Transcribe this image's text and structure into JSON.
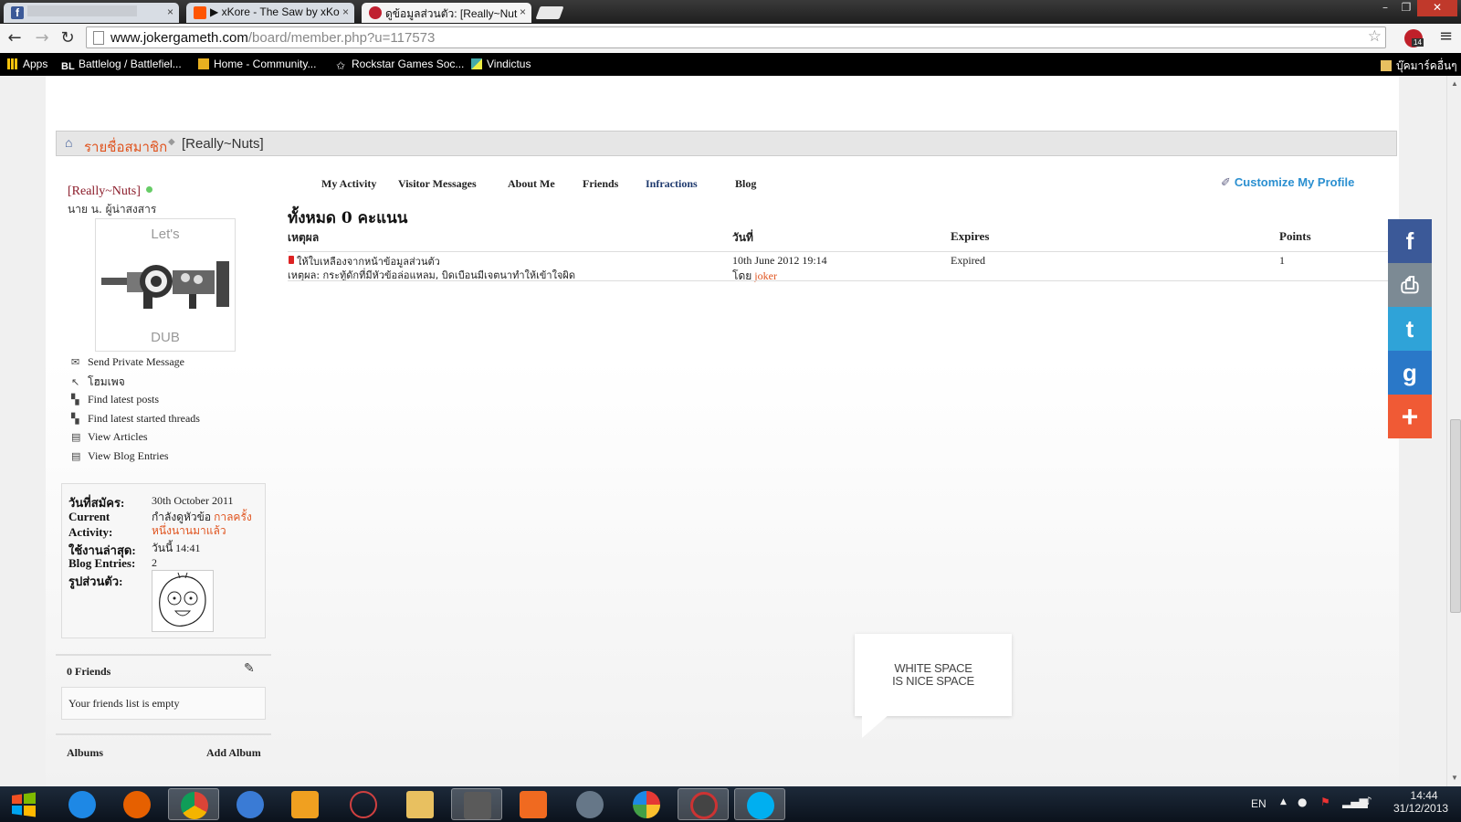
{
  "browser": {
    "tabs": [
      {
        "title": "",
        "icon": "facebook-icon",
        "color": "#3b5998"
      },
      {
        "title": "▶ xKore - The Saw by xKo",
        "icon": "soundcloud-icon",
        "color": "#ff5500"
      },
      {
        "title": "ดูข้อมูลส่วนตัว: [Really~Nut",
        "icon": "site-icon",
        "color": "#c02030"
      }
    ],
    "close_glyph": "×",
    "window_controls": {
      "minimize": "–",
      "restore": "❐",
      "close": "✕"
    },
    "url": {
      "domain": "www.jokergameth.com",
      "path": "/board/member.php?u=117573"
    },
    "extension_badge": "14",
    "bookmarks": [
      {
        "label": "Apps",
        "icon": "apps-icon"
      },
      {
        "label": "Battlelog / Battlefiel...",
        "icon": "battlelog-icon"
      },
      {
        "label": "Home - Community...",
        "icon": "community-icon"
      },
      {
        "label": "Rockstar Games Soc...",
        "icon": "rockstar-icon"
      },
      {
        "label": "Vindictus",
        "icon": "vindictus-icon"
      }
    ],
    "other_bookmarks": "บุ๊คมาร์คอื่นๆ"
  },
  "breadcrumb": {
    "members": "รายชื่อสมาชิก",
    "current": "[Really~Nuts]"
  },
  "profile": {
    "username": "[Really~Nuts]",
    "user_title": "นาย น. ผู้น่าสงสาร",
    "avatar_text_top": "Let's",
    "avatar_text_bottom": "DUB",
    "links": [
      {
        "label": "Send Private Message",
        "icon": "envelope-icon",
        "glyph": "✉"
      },
      {
        "label": "โฮมเพจ",
        "icon": "cursor-icon",
        "glyph": "↖"
      },
      {
        "label": "Find latest posts",
        "icon": "posts-icon",
        "glyph": "▚"
      },
      {
        "label": "Find latest started threads",
        "icon": "threads-icon",
        "glyph": "▚"
      },
      {
        "label": "View Articles",
        "icon": "articles-icon",
        "glyph": "▤"
      },
      {
        "label": "View Blog Entries",
        "icon": "blog-icon",
        "glyph": "▤"
      }
    ],
    "info": {
      "join_label": "วันที่สมัคร:",
      "join_value": "30th October 2011",
      "activity_label_1": "Current",
      "activity_label_2": "Activity:",
      "activity_value": "กำลังดูหัวข้อ",
      "activity_link_1": "กาลครั้ง",
      "activity_link_2": "หนึ่งนานมาแล้ว",
      "last_label": "ใช้งานล่าสุด:",
      "last_value": "วันนี้ 14:41",
      "blog_label": "Blog Entries:",
      "blog_value": "2",
      "pic_label": "รูปส่วนตัว:"
    },
    "friends_title": "0 Friends",
    "friends_empty": "Your friends list is empty",
    "albums_title": "Albums",
    "albums_add": "Add Album"
  },
  "main": {
    "tabs": [
      "My Activity",
      "Visitor Messages",
      "About Me",
      "Friends",
      "Infractions",
      "Blog"
    ],
    "customize": "Customize My Profile",
    "total": "ทั้งหมด 0 คะแนน",
    "headers": {
      "reason": "เหตุผล",
      "date": "วันที่",
      "expires": "Expires",
      "points": "Points"
    },
    "row": {
      "reason_title": "ให้ใบเหลืองจากหน้าข้อมูลส่วนตัว",
      "reason_detail": "เหตุผล: กระทู้ดักที่มีหัวข้อล่อแหลม, บิดเบือนมีเจตนาทำให้เข้าใจผิด",
      "date": "10th June 2012 19:14",
      "by_label": "โดย",
      "by_user": "joker",
      "expires": "Expired",
      "points": "1"
    }
  },
  "share": [
    {
      "name": "facebook",
      "glyph": "f",
      "color": "#3b5998"
    },
    {
      "name": "print",
      "glyph": "⎙",
      "color": "#7c8a94"
    },
    {
      "name": "twitter",
      "glyph": "t",
      "color": "#2fa3d8"
    },
    {
      "name": "google",
      "glyph": "g",
      "color": "#2a78c8"
    },
    {
      "name": "more",
      "glyph": "+",
      "color": "#f05a35"
    }
  ],
  "bubble": {
    "line1": "WHITE SPACE",
    "line2": "IS NICE SPACE"
  },
  "taskbar": {
    "apps": [
      {
        "name": "ie",
        "color": "#1e88e5"
      },
      {
        "name": "firefox",
        "color": "#e66000"
      },
      {
        "name": "chrome",
        "color": "#2e9d3f"
      },
      {
        "name": "safari",
        "color": "#3a7bd5"
      },
      {
        "name": "media-player",
        "color": "#f0a020"
      },
      {
        "name": "rockstar",
        "color": "#d04040"
      },
      {
        "name": "file-explorer",
        "color": "#e8c060"
      },
      {
        "name": "steam",
        "color": "#5a5a5a"
      },
      {
        "name": "origin",
        "color": "#f06a20"
      },
      {
        "name": "vindictus",
        "color": "#667788"
      },
      {
        "name": "picasa",
        "color": "#7cc242"
      },
      {
        "name": "nero",
        "color": "#444444"
      },
      {
        "name": "skype",
        "color": "#00aff0"
      }
    ],
    "lang": "EN",
    "time": "14:44",
    "date": "31/12/2013"
  }
}
